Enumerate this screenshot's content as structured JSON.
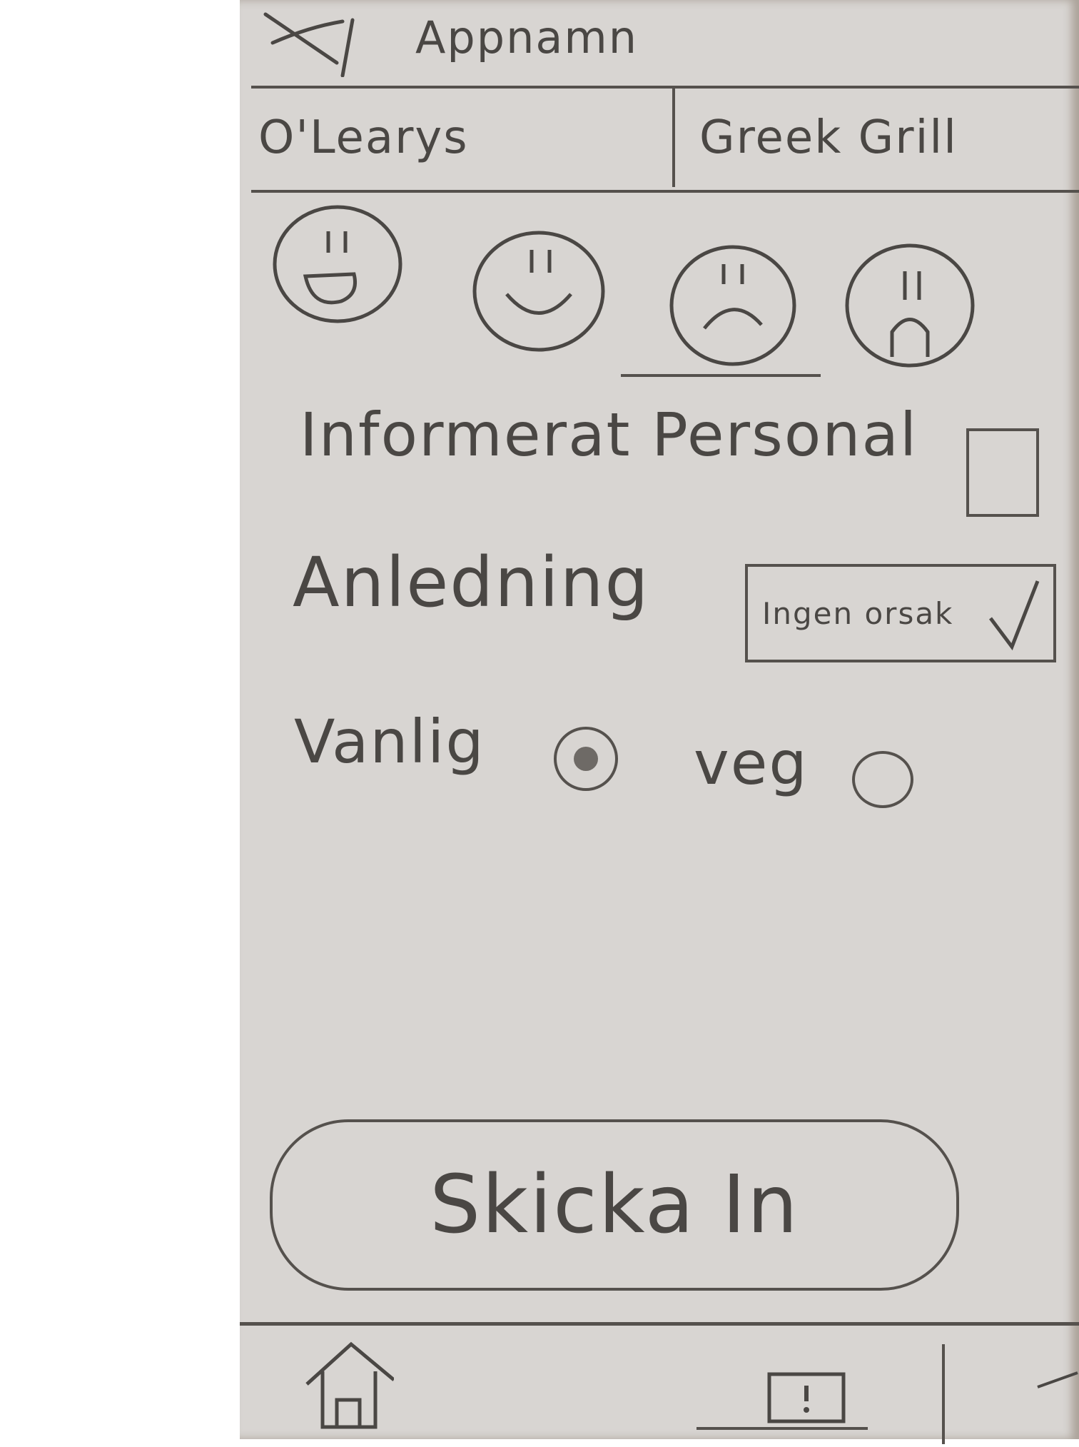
{
  "header": {
    "title": "Appnamn",
    "close_icon": "close-icon"
  },
  "tabs": [
    {
      "label": "O'Learys"
    },
    {
      "label": "Greek Grill"
    }
  ],
  "rating": {
    "options": [
      "very-happy-face-icon",
      "happy-face-icon",
      "sad-face-icon",
      "very-sad-face-icon"
    ],
    "selected_index": 2
  },
  "form": {
    "informed_staff_label": "Informerat Personal",
    "informed_staff_checked": false,
    "reason_label": "Anledning",
    "reason_value": "Ingen orsak",
    "meal_option_1_label": "Vanlig",
    "meal_option_2_label": "veg",
    "meal_selected": "Vanlig"
  },
  "submit": {
    "label": "Skicka In"
  },
  "bottom_nav": {
    "items": [
      "home-icon",
      "report-icon",
      "more-icon"
    ]
  },
  "colors": {
    "paper": "#d8d5d2",
    "pencil": "#4a4744"
  }
}
